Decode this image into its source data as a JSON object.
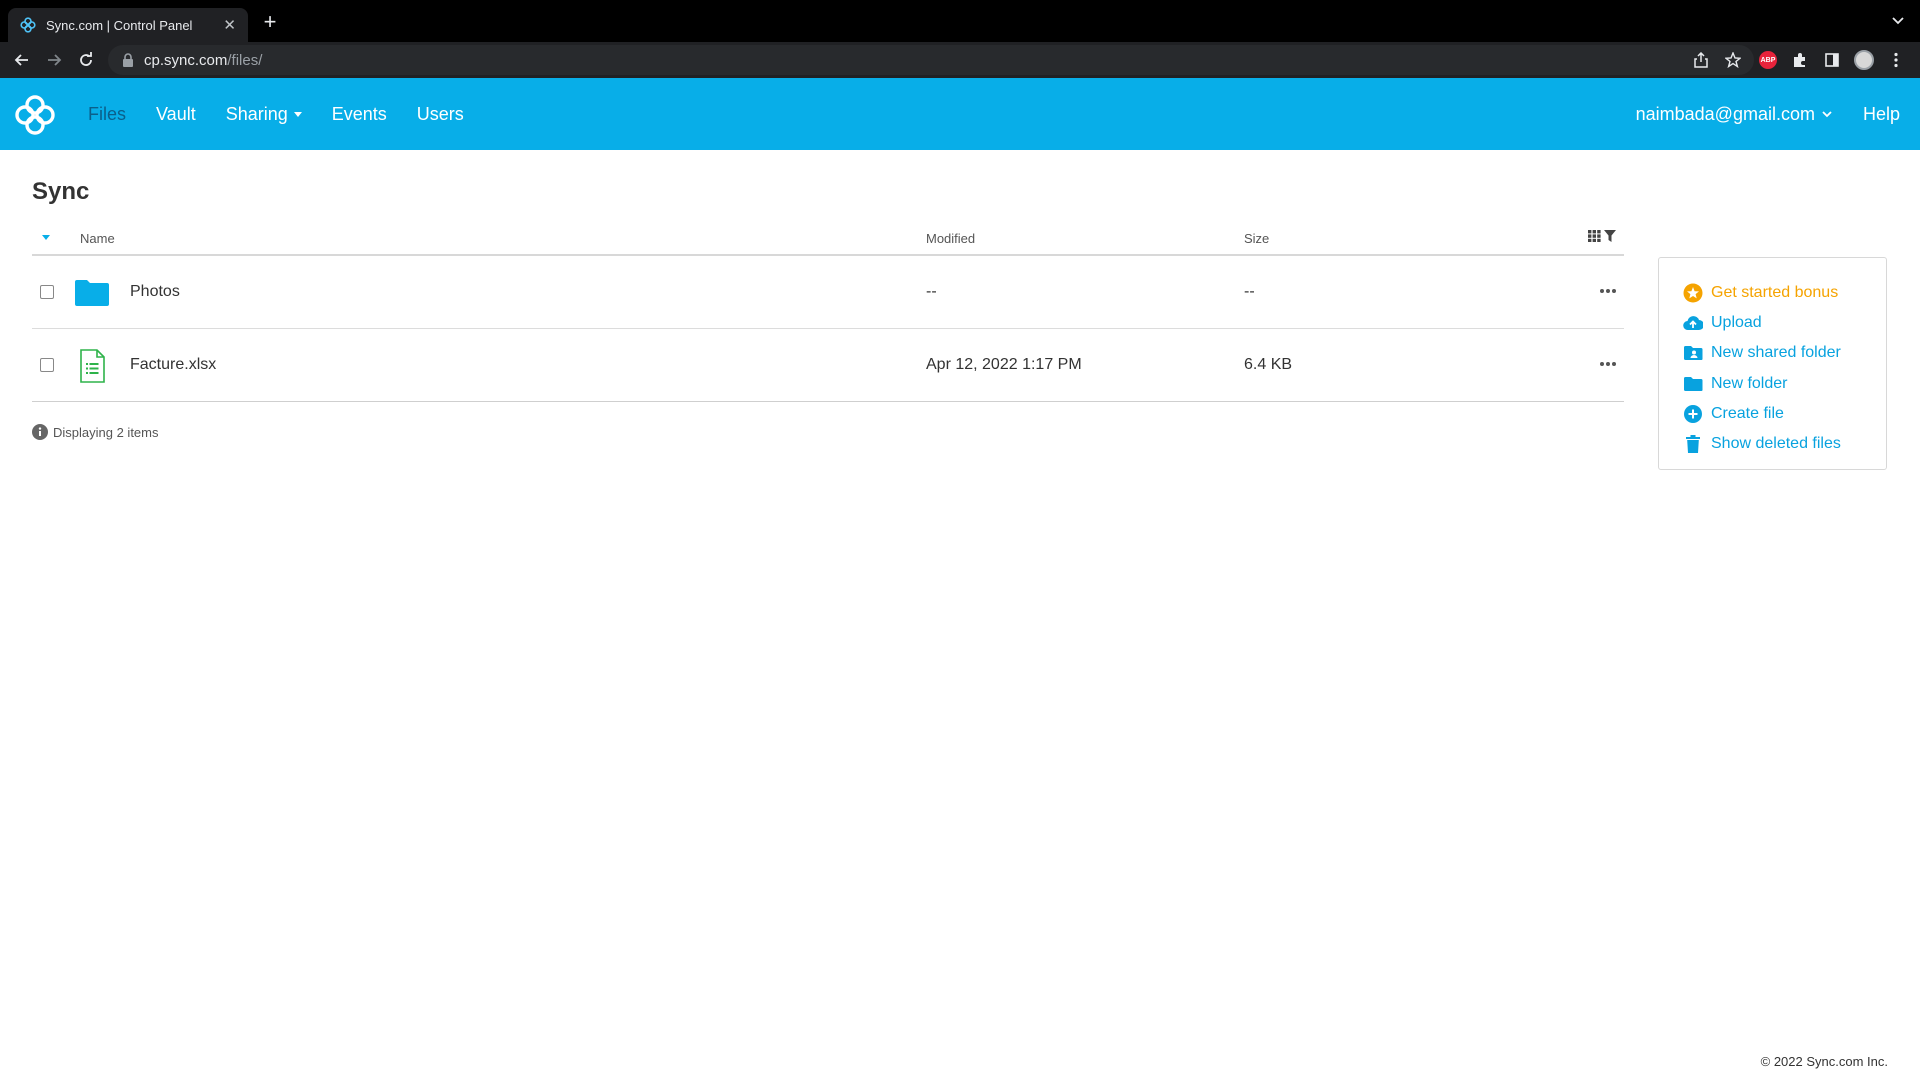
{
  "browser": {
    "tab_title": "Sync.com | Control Panel",
    "url_host": "cp.sync.com",
    "url_path": "/files/",
    "extension_badge": "ABP"
  },
  "header": {
    "nav": [
      {
        "label": "Files",
        "active": true
      },
      {
        "label": "Vault"
      },
      {
        "label": "Sharing"
      },
      {
        "label": "Events"
      },
      {
        "label": "Users"
      }
    ],
    "user_email": "naimbada@gmail.com",
    "help_label": "Help"
  },
  "page": {
    "title": "Sync"
  },
  "table": {
    "columns": {
      "name": "Name",
      "modified": "Modified",
      "size": "Size"
    },
    "rows": [
      {
        "name": "Photos",
        "modified": "--",
        "size": "--",
        "icon": "folder-icon"
      },
      {
        "name": "Facture.xlsx",
        "modified": "Apr 12, 2022 1:17 PM",
        "size": "6.4 KB",
        "icon": "spreadsheet-file-icon"
      }
    ],
    "count_text": "Displaying 2 items"
  },
  "actions": [
    {
      "label": "Get started bonus",
      "icon": "star-badge-icon"
    },
    {
      "label": "Upload",
      "icon": "cloud-upload-icon"
    },
    {
      "label": "New shared folder",
      "icon": "shared-folder-icon"
    },
    {
      "label": "New folder",
      "icon": "folder-icon"
    },
    {
      "label": "Create file",
      "icon": "plus-circle-icon"
    },
    {
      "label": "Show deleted files",
      "icon": "trash-icon"
    }
  ],
  "footer": {
    "copyright": "© 2022 Sync.com Inc."
  },
  "colors": {
    "brand_blue": "#08aee8",
    "link_blue": "#08a2df",
    "bonus_orange": "#f5a300",
    "active_nav": "#0b5f8a"
  }
}
